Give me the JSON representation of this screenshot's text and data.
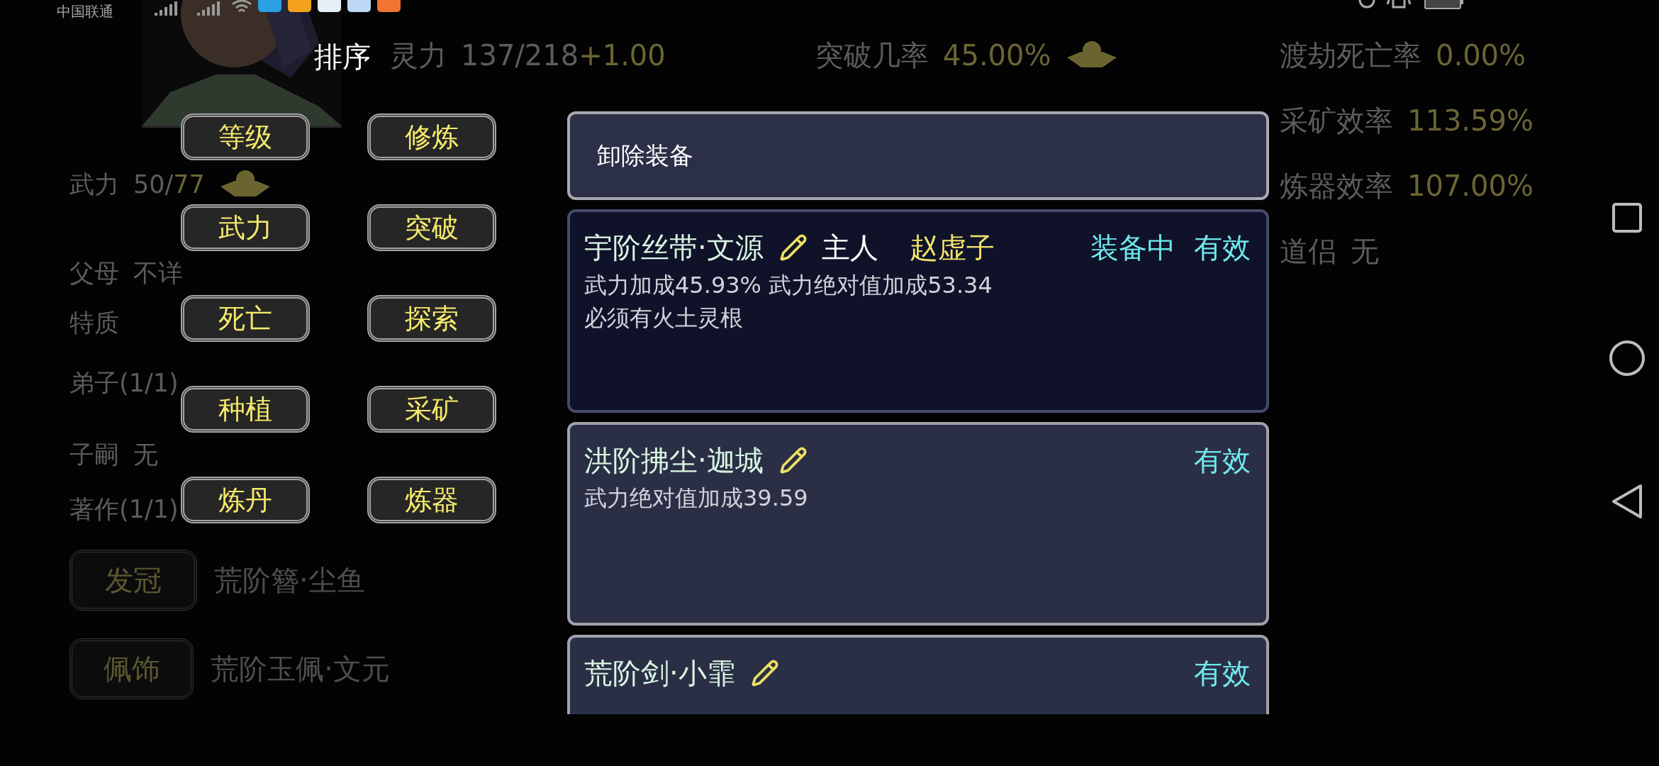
{
  "status_bar": {
    "carrier": "中国联通"
  },
  "stat_columns": [
    {
      "items": [
        {
          "label": "武力",
          "value": "50/",
          "highlight": "77",
          "upgrade": true
        },
        {
          "label": "父母",
          "value": "不详",
          "upgrade": false
        },
        {
          "label": "特质",
          "upgrade": false
        },
        {
          "label": "弟子(1/1)",
          "upgrade": false
        },
        {
          "label": "子嗣",
          "value": "无",
          "upgrade": false
        },
        {
          "label": "著作(1/1)",
          "upgrade": false
        }
      ]
    },
    {
      "items": [
        {
          "label": "灵力",
          "value": "137/218",
          "highlight": "+1.00",
          "upgrade": false
        }
      ]
    },
    {
      "items": [
        {
          "label": "突破几率",
          "highlight": "45.00%",
          "upgrade": true
        }
      ]
    },
    {
      "items": [
        {
          "label": "渡劫死亡率",
          "highlight": "0.00%",
          "upgrade": false
        },
        {
          "label": "采矿效率",
          "highlight": "113.59%",
          "upgrade": false
        },
        {
          "label": "炼器效率",
          "highlight": "107.00%",
          "upgrade": false
        },
        {
          "label": "道侣",
          "value": "无",
          "upgrade": false
        }
      ]
    }
  ],
  "equipment_slots": [
    {
      "label": "发冠",
      "item": "荒阶簪·尘鱼"
    },
    {
      "label": "佩饰",
      "item": "荒阶玉佩·文元"
    }
  ],
  "sort_menu": {
    "title": "排序",
    "options": [
      "等级",
      "修炼",
      "武力",
      "突破",
      "死亡",
      "探索",
      "种植",
      "采矿",
      "炼丹",
      "炼器"
    ]
  },
  "equipment_panel": {
    "action": "卸除装备",
    "items": [
      {
        "name": "宇阶丝带·文源",
        "owner_label": "主人",
        "owner": "赵虚子",
        "status": "装备中",
        "validity": "有效",
        "equipped": true,
        "lines": [
          "武力加成45.93% 武力绝对值加成53.34",
          "必须有火土灵根"
        ]
      },
      {
        "name": "洪阶拂尘·迦城",
        "validity": "有效",
        "equipped": false,
        "lines": [
          "武力绝对值加成39.59"
        ]
      },
      {
        "name": "荒阶剑·小霏",
        "validity": "有效",
        "equipped": false
      }
    ]
  }
}
